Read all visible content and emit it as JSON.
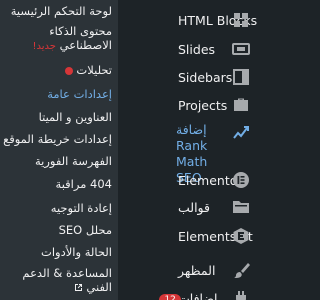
{
  "submenu": {
    "items": [
      {
        "label": "لوحة التحكم الرئيسية"
      },
      {
        "label": "محتوى الذكاء الاصطناعي",
        "badge": "جديد!"
      },
      {
        "label": "تحليلات"
      },
      {
        "label": "إعدادات عامة"
      },
      {
        "label": "العناوين و الميتا"
      },
      {
        "label": "إعدادات خريطة الموقع"
      },
      {
        "label": "الفهرسة الفورية"
      },
      {
        "label": "404 مراقبة"
      },
      {
        "label": "إعادة التوجيه"
      },
      {
        "label": "محلل SEO"
      },
      {
        "label": "الحالة والأدوات"
      },
      {
        "label": "المساعدة & الدعم الفني"
      }
    ]
  },
  "main_menu": {
    "items": [
      {
        "label": "HTML Blocks",
        "icon": "grid-icon"
      },
      {
        "label": "Slides",
        "icon": "slides-icon"
      },
      {
        "label": "Sidebars",
        "icon": "sidebar-icon"
      },
      {
        "label": "Projects",
        "icon": "briefcase-icon"
      },
      {
        "label": "إضافة Rank Math SEO",
        "icon": "rank-math-icon"
      },
      {
        "label": "Elementor",
        "icon": "elementor-icon"
      },
      {
        "label": "قوالب",
        "icon": "folder-icon"
      },
      {
        "label": "ElementsKit",
        "icon": "elementskit-icon"
      },
      {
        "label": "المظهر",
        "icon": "brush-icon"
      },
      {
        "label": "إضافات",
        "badge": "12",
        "icon": "plugin-icon"
      }
    ]
  },
  "colors": {
    "menu_bg": "#1d2327",
    "submenu_bg": "#2c3338",
    "text": "#f0f0f1",
    "active": "#72aee6",
    "badge_red": "#d63638"
  }
}
